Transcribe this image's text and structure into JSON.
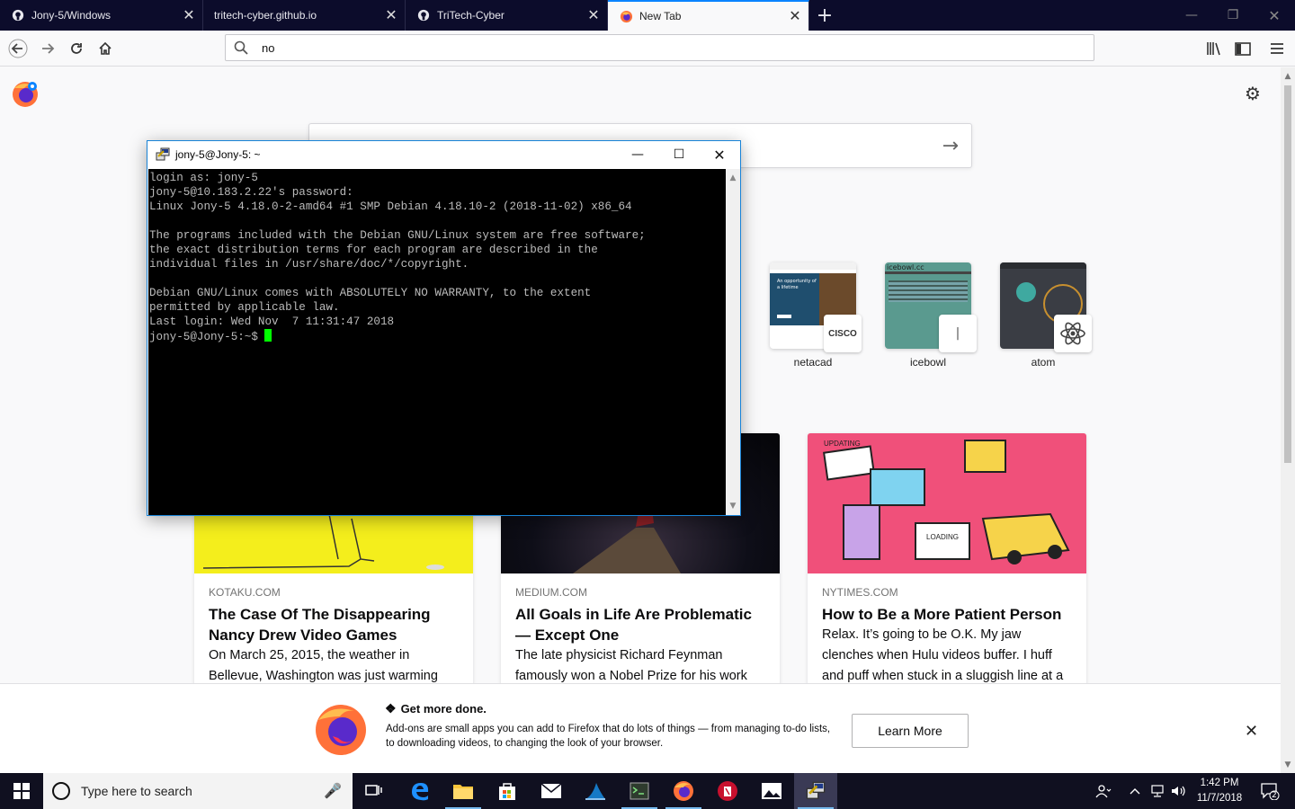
{
  "browser": {
    "tabs": [
      {
        "label": "Jony-5/Windows",
        "icon": "github-icon",
        "active": false
      },
      {
        "label": "tritech-cyber.github.io",
        "icon": "none",
        "active": false
      },
      {
        "label": "TriTech-Cyber",
        "icon": "github-icon",
        "active": false
      },
      {
        "label": "New Tab",
        "icon": "firefox-icon",
        "active": true
      }
    ],
    "tab_close_glyph": "✕",
    "new_tab_glyph": "+",
    "url_value": "no",
    "accent_color": "#0a84ff"
  },
  "topsites": [
    {
      "label": "netacad",
      "thumb_text": "An opportunity of a lifetime",
      "badge": "CISCO"
    },
    {
      "label": "icebowl",
      "thumb_text": "icebowl.cc"
    },
    {
      "label": "atom"
    }
  ],
  "stories": [
    {
      "source": "KOTAKU.COM",
      "title": "The Case Of The Disappearing Nancy Drew Video Games",
      "desc": "On March 25, 2015, the weather in Bellevue, Washington was just warming"
    },
    {
      "source": "MEDIUM.COM",
      "title": "All Goals in Life Are Problematic — Except One",
      "desc": "The late physicist Richard Feynman famously won a Nobel Prize for his work"
    },
    {
      "source": "NYTIMES.COM",
      "title": "How to Be a More Patient Person",
      "desc": "Relax. It’s going to be O.K. My jaw clenches when Hulu videos buffer. I huff and puff when stuck in a sluggish line at a",
      "img_words": [
        "UPDATING",
        "LOADING"
      ]
    }
  ],
  "banner": {
    "title": "Get more done.",
    "text": "Add-ons are small apps you can add to Firefox that do lots of things — from managing to-do lists, to downloading videos, to changing the look of your browser.",
    "button": "Learn More",
    "close_glyph": "✕"
  },
  "putty": {
    "title": "jony-5@Jony-5: ~",
    "lines": [
      "login as: jony-5",
      "jony-5@10.183.2.22's password:",
      "Linux Jony-5 4.18.0-2-amd64 #1 SMP Debian 4.18.10-2 (2018-11-02) x86_64",
      "",
      "The programs included with the Debian GNU/Linux system are free software;",
      "the exact distribution terms for each program are described in the",
      "individual files in /usr/share/doc/*/copyright.",
      "",
      "Debian GNU/Linux comes with ABSOLUTELY NO WARRANTY, to the extent",
      "permitted by applicable law.",
      "Last login: Wed Nov  7 11:31:47 2018"
    ],
    "prompt": "jony-5@Jony-5:~$ ",
    "cursor_color": "#00ff00"
  },
  "taskbar": {
    "search_placeholder": "Type here to search",
    "apps": [
      "task-view-icon",
      "edge-icon",
      "file-explorer-icon",
      "store-icon",
      "mail-icon",
      "wireshark-icon",
      "terminal-app-icon",
      "firefox-icon",
      "app-red-icon",
      "photos-icon",
      "putty-icon"
    ],
    "time": "1:42 PM",
    "date": "11/7/2018",
    "notification_count": "2"
  }
}
